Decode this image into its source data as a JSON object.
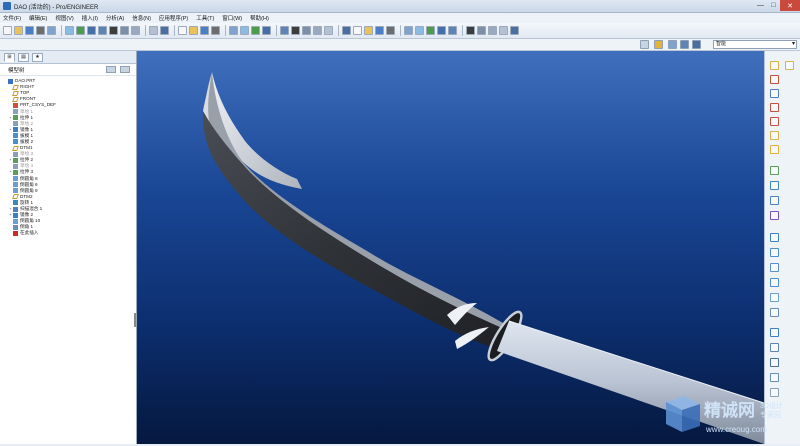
{
  "window": {
    "title": "DAO (活动的) - Pro/ENGINEER",
    "controls": [
      "—",
      "□",
      "✕"
    ]
  },
  "menubar": {
    "items": [
      "文件(F)",
      "编辑(E)",
      "视图(V)",
      "插入(I)",
      "分析(A)",
      "信息(N)",
      "应用程序(P)",
      "工具(T)",
      "窗口(W)",
      "帮助(H)"
    ]
  },
  "filter": {
    "value": "智能"
  },
  "model_tree": {
    "title": "模型树",
    "items": [
      {
        "label": "DAO.PRT",
        "icon": "part-icon",
        "depth": 0,
        "expand": "",
        "gray": false
      },
      {
        "label": "RIGHT",
        "icon": "datum-plane-icon",
        "depth": 1,
        "expand": "",
        "gray": false
      },
      {
        "label": "TOP",
        "icon": "datum-plane-icon",
        "depth": 1,
        "expand": "",
        "gray": false
      },
      {
        "label": "FRONT",
        "icon": "datum-plane-icon",
        "depth": 1,
        "expand": "",
        "gray": false
      },
      {
        "label": "PRT_CSYS_DEF",
        "icon": "csys-icon",
        "depth": 1,
        "expand": "",
        "gray": false
      },
      {
        "label": "草绘 1",
        "icon": "sketch-icon",
        "depth": 1,
        "expand": "",
        "gray": true
      },
      {
        "label": "拉伸 1",
        "icon": "extrude-icon",
        "depth": 1,
        "expand": "+",
        "gray": false
      },
      {
        "label": "草绘 2",
        "icon": "sketch-icon",
        "depth": 1,
        "expand": "",
        "gray": true
      },
      {
        "label": "镜像 1",
        "icon": "mirror-icon",
        "depth": 1,
        "expand": "+",
        "gray": false
      },
      {
        "label": "拔模 1",
        "icon": "draft-icon",
        "depth": 1,
        "expand": "",
        "gray": false
      },
      {
        "label": "拔模 2",
        "icon": "draft-icon",
        "depth": 1,
        "expand": "",
        "gray": false
      },
      {
        "label": "DTM1",
        "icon": "datum-plane-icon",
        "depth": 1,
        "expand": "",
        "gray": false
      },
      {
        "label": "草绘 3",
        "icon": "sketch-icon",
        "depth": 1,
        "expand": "",
        "gray": true
      },
      {
        "label": "拉伸 2",
        "icon": "extrude-icon",
        "depth": 1,
        "expand": "+",
        "gray": false
      },
      {
        "label": "草绘 4",
        "icon": "sketch-icon",
        "depth": 1,
        "expand": "",
        "gray": true
      },
      {
        "label": "拉伸 3",
        "icon": "extrude-icon",
        "depth": 1,
        "expand": "+",
        "gray": false
      },
      {
        "label": "倒圆角 8",
        "icon": "round-icon",
        "depth": 1,
        "expand": "",
        "gray": false
      },
      {
        "label": "倒圆角 6",
        "icon": "round-icon",
        "depth": 1,
        "expand": "",
        "gray": false
      },
      {
        "label": "倒圆角 9",
        "icon": "round-icon",
        "depth": 1,
        "expand": "",
        "gray": false
      },
      {
        "label": "DTM2",
        "icon": "datum-plane-icon",
        "depth": 1,
        "expand": "",
        "gray": false
      },
      {
        "label": "旋转 1",
        "icon": "revolve-icon",
        "depth": 1,
        "expand": "",
        "gray": false
      },
      {
        "label": "扫描混合 1",
        "icon": "sweep-blend-icon",
        "depth": 1,
        "expand": "+",
        "gray": false
      },
      {
        "label": "镜像 2",
        "icon": "mirror-icon",
        "depth": 1,
        "expand": "+",
        "gray": false
      },
      {
        "label": "倒圆角 10",
        "icon": "round-icon",
        "depth": 1,
        "expand": "",
        "gray": false
      },
      {
        "label": "倒角 1",
        "icon": "chamfer-icon",
        "depth": 1,
        "expand": "",
        "gray": false
      },
      {
        "label": "在此插入",
        "icon": "insert-here-icon",
        "depth": 1,
        "expand": "",
        "gray": false
      }
    ]
  },
  "watermark": {
    "brand": "精诚网",
    "tag1": "3D设计",
    "tag2": "专家园",
    "url": "www.creoug.com"
  },
  "colors": {
    "accent": "#2e6bb8",
    "viewport_top": "#3f6fbd",
    "viewport_bottom": "#05183f"
  }
}
